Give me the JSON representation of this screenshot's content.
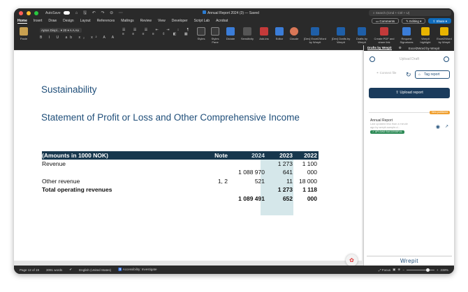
{
  "window": {
    "autosave_label": "AutoSave",
    "doc_title": "Annual Report 2024 (3) — Saved",
    "search_placeholder": "Search (Cmd + Ctrl + U)"
  },
  "menu": {
    "tabs": [
      "Home",
      "Insert",
      "Draw",
      "Design",
      "Layout",
      "References",
      "Mailings",
      "Review",
      "View",
      "Developer",
      "Script Lab",
      "Acrobat"
    ],
    "comments_label": "Comments",
    "editing_label": "Editing",
    "share_label": "Share"
  },
  "ribbon": {
    "paste": "Paste",
    "font_name": "Aptos Displ...",
    "font_size": "20",
    "styles": "Styles",
    "styles_pane": "Styles Pane",
    "dictate": "Dictate",
    "sensitivity": "Sensitivity",
    "add_ins": "Add-ins",
    "editor": "Editor",
    "claude": "Claude",
    "excel2word": "[Dev] Excel2Word by Wrepit",
    "drafts_dev": "[Dev] Drafts by Wrepit",
    "drafts": "Drafts by Wrepit",
    "create_pdf": "Create PDF and share link",
    "request_sig": "Request Signatures",
    "wrepit_highlight": "Wrepit highlight",
    "excel2word2": "Excel2Word by Wrepit"
  },
  "document": {
    "heading1": "Sustainability",
    "heading2": "Statement of Profit or Loss and Other Comprehensive Income",
    "table": {
      "headers": {
        "label": "(Amounts in 1000 NOK)",
        "note": "Note",
        "y2024": "2024",
        "y2023": "2023",
        "y2022": "2022"
      },
      "rows": [
        {
          "label": "Revenue",
          "note": "",
          "y2024": "",
          "y2023": "1 273",
          "y2022": "1 100"
        },
        {
          "label": "",
          "note": "",
          "y2024": "1 088 970",
          "y2023": "641",
          "y2022": "000"
        },
        {
          "label": "Other revenue",
          "note": "1, 2",
          "y2024": "521",
          "y2023": "11",
          "y2022": "18 000"
        },
        {
          "label": "Total operating revenues",
          "note": "",
          "y2024": "",
          "y2023": "1 273",
          "y2022": "1 118"
        },
        {
          "label": "",
          "note": "",
          "y2024": "1 089 491",
          "y2023": "652",
          "y2022": "000"
        }
      ]
    }
  },
  "panel": {
    "tab_drafts": "Drafts by Wrepit",
    "tab_excel2word": "Excel2Word by Wrepit",
    "header": "Upload Draft",
    "connect_file": "Connect file",
    "tag_report": "Tag report",
    "upload_report": "Upload report",
    "card": {
      "title": "Annual Report",
      "subtitle": "Last updated less than a minute ago by wrepit-sample-d...",
      "status_badge": "UPLOAD SUCCESSFUL",
      "new_badge": "New published"
    },
    "brand": "Wrepit"
  },
  "status": {
    "page": "Page 12 of 19",
    "words": "3091 words",
    "language": "English (United States)",
    "accessibility": "Accessibility: Investigate",
    "focus": "Focus",
    "zoom": "238%",
    "zoom_level_fraction": 0.7
  }
}
